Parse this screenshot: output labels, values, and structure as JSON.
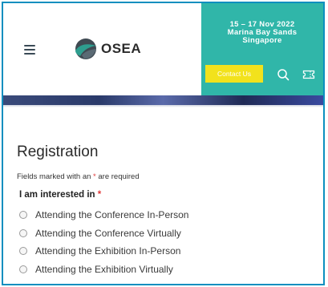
{
  "header": {
    "event": {
      "dates": "15 – 17 Nov 2022",
      "venue": "Marina Bay Sands",
      "city": "Singapore"
    },
    "logo_text": "OSEA",
    "contact_label": "Contact Us",
    "colors": {
      "teal": "#30b6a9",
      "contact_bg": "#f2e21c"
    }
  },
  "form": {
    "title": "Registration",
    "note_prefix": "Fields marked with an ",
    "note_star": "*",
    "note_suffix": " are required",
    "field_label": "I am interested in ",
    "field_star": "*",
    "options": [
      "Attending the Conference In-Person",
      "Attending the Conference Virtually",
      "Attending the Exhibition In-Person",
      "Attending the Exhibition Virtually"
    ]
  }
}
